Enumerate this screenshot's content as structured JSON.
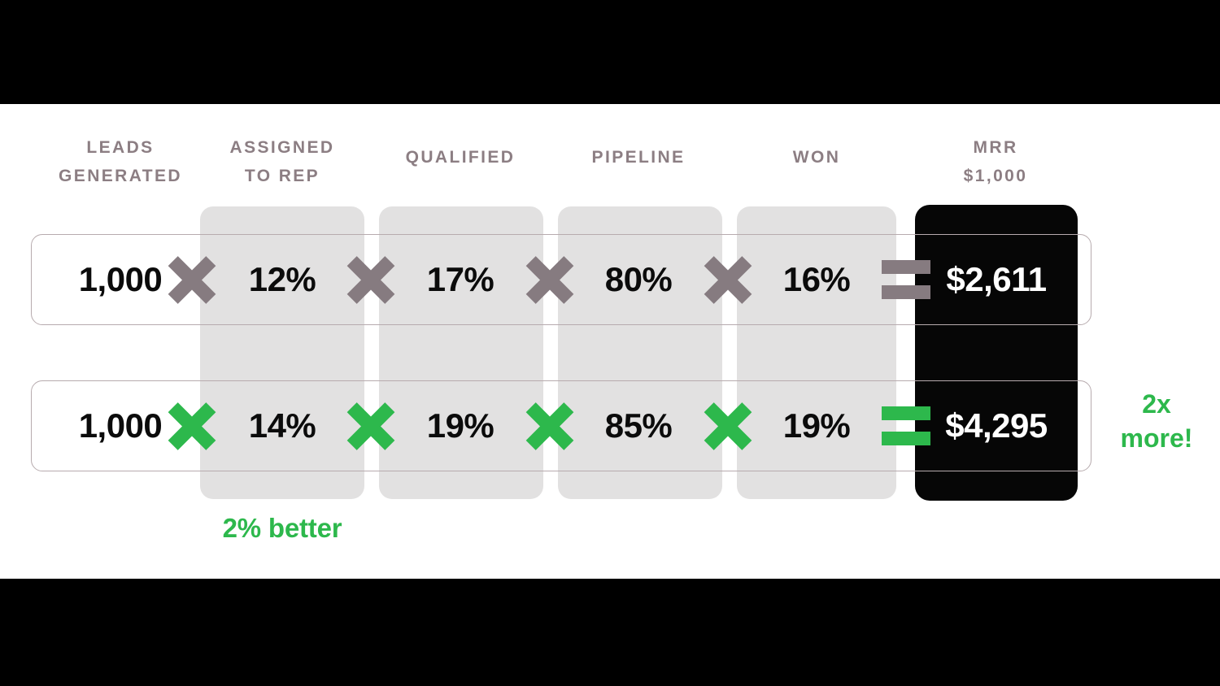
{
  "palette": {
    "background": "#ffffff",
    "letterbox": "#000000",
    "header_text": "#8c7e83",
    "panel_gray": "#e2e1e1",
    "panel_black": "#060606",
    "row_border": "#b7abae",
    "value_text": "#0b0b0b",
    "value_text_inverse": "#ffffff",
    "operator_gray": "#867b80",
    "operator_green": "#2db84c",
    "accent_green": "#2db84c"
  },
  "chart_data": {
    "type": "table",
    "title": "",
    "columns": [
      {
        "key": "leads",
        "label": "LEADS\nGENERATED",
        "highlight": false
      },
      {
        "key": "assigned",
        "label": "ASSIGNED\nTO REP",
        "highlight": true
      },
      {
        "key": "qualified",
        "label": "QUALIFIED",
        "highlight": true
      },
      {
        "key": "pipeline",
        "label": "PIPELINE",
        "highlight": true
      },
      {
        "key": "won",
        "label": "WON",
        "highlight": true
      },
      {
        "key": "mrr",
        "label": "MRR\n$1,000",
        "highlight": true
      }
    ],
    "operators": [
      "×",
      "×",
      "×",
      "×",
      "="
    ],
    "rows": [
      {
        "name": "baseline",
        "operator_color": "#867b80",
        "values": [
          "1,000",
          "12%",
          "17%",
          "80%",
          "16%",
          "$2,611"
        ],
        "numeric": [
          1000,
          0.12,
          0.17,
          0.8,
          0.16,
          2611
        ]
      },
      {
        "name": "improved",
        "operator_color": "#2db84c",
        "values": [
          "1,000",
          "14%",
          "19%",
          "85%",
          "19%",
          "$4,295"
        ],
        "numeric": [
          1000,
          0.14,
          0.19,
          0.85,
          0.19,
          4295
        ]
      }
    ],
    "annotations": [
      {
        "key": "better",
        "text": "2% better",
        "color": "#2db84c",
        "anchor": "assigned-column-below"
      },
      {
        "key": "more",
        "text": "2x\nmore!",
        "color": "#2db84c",
        "anchor": "right-of-mrr-row-2"
      }
    ]
  },
  "headers": {
    "leads": "LEADS\nGENERATED",
    "assigned": "ASSIGNED\nTO REP",
    "qualified": "QUALIFIED",
    "pipeline": "PIPELINE",
    "won": "WON",
    "mrr": "MRR\n$1,000"
  },
  "row1": {
    "leads": "1,000",
    "assigned": "12%",
    "qualified": "17%",
    "pipeline": "80%",
    "won": "16%",
    "mrr": "$2,611"
  },
  "row2": {
    "leads": "1,000",
    "assigned": "14%",
    "qualified": "19%",
    "pipeline": "85%",
    "won": "19%",
    "mrr": "$4,295"
  },
  "annotations": {
    "better": "2% better",
    "more": "2x\nmore!"
  }
}
